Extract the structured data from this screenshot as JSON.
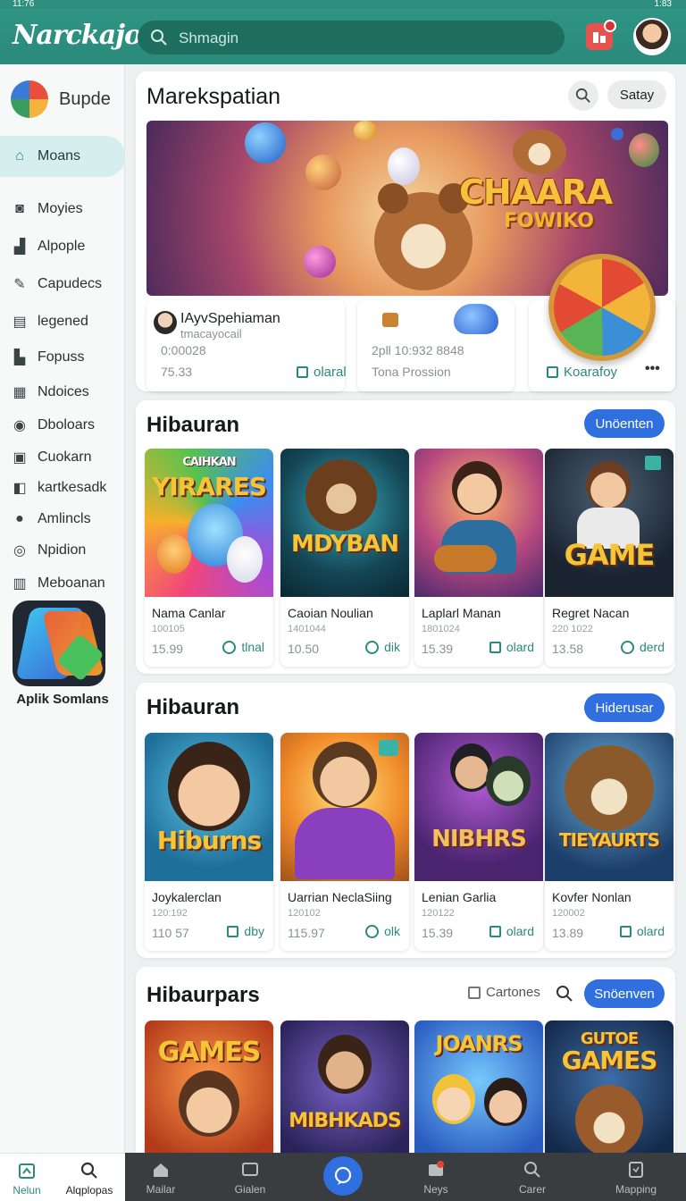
{
  "status": {
    "time": "11:76",
    "right": "1:83"
  },
  "app": {
    "logo": "Narckajoe"
  },
  "search": {
    "placeholder": "Shmagin"
  },
  "sidebar": {
    "brand": "Bupde",
    "items": [
      {
        "label": "Moans",
        "icon": "home-icon"
      },
      {
        "label": "Moyies",
        "icon": "camera-icon"
      },
      {
        "label": "Alpople",
        "icon": "thumb-icon"
      },
      {
        "label": "Capudecs",
        "icon": "pen-icon"
      },
      {
        "label": "legened",
        "icon": "list-icon"
      },
      {
        "label": "Fopuss",
        "icon": "chart-icon"
      },
      {
        "label": "Ndoices",
        "icon": "grid-icon"
      },
      {
        "label": "Dboloars",
        "icon": "eye-icon"
      },
      {
        "label": "Cuokarn",
        "icon": "board-icon"
      },
      {
        "label": "kartkesadk",
        "icon": "edit-icon"
      },
      {
        "label": "Amlincls",
        "icon": "pin-icon"
      },
      {
        "label": "Npidion",
        "icon": "location-icon"
      },
      {
        "label": "Meboanan",
        "icon": "calendar-icon"
      }
    ],
    "app_label": "Aplik Somlans"
  },
  "featured": {
    "title": "Marekspatian",
    "button": "Satay",
    "hero_title": "CHAARA",
    "hero_sub": "FOWIKO",
    "cards": [
      {
        "title": "IAyvSpehiaman",
        "subtitle": "tmacayocail",
        "id": "0:00028",
        "value": "75.33",
        "action": "olaral"
      },
      {
        "id": "2pll 10:932 8848",
        "value": "Tona Prossion"
      },
      {
        "action": "Koarafoy",
        "more": "•••"
      }
    ]
  },
  "section1": {
    "title": "Hibauran",
    "button": "Unöenten",
    "tiles": [
      {
        "art": "YIRARES",
        "art_top": "CAIHKAN",
        "name": "Nama Canlar",
        "id": "100105",
        "price": "15.99",
        "action": "tlnal"
      },
      {
        "art": "MDYBAN",
        "art_top": "",
        "name": "Caoian Noulian",
        "id": "1401044",
        "price": "10.50",
        "action": "dik"
      },
      {
        "art": "",
        "art_top": "",
        "name": "Laplarl Manan",
        "id": "1801024",
        "price": "15.39",
        "action": "olard"
      },
      {
        "art": "GAME",
        "art_top": "",
        "name": "Regret Nacan",
        "id": "220 1022",
        "price": "13.58",
        "action": "derd"
      }
    ]
  },
  "section2": {
    "title": "Hibauran",
    "button": "Hiderusar",
    "tiles": [
      {
        "art": "Hiburns",
        "name": "Joykalerclan",
        "id": "120:192",
        "price": "110 57",
        "action": "dby"
      },
      {
        "art": "",
        "name": "Uarrian NeclaSiing",
        "id": "120102",
        "price": "115.97",
        "action": "olk"
      },
      {
        "art": "NIBHRS",
        "name": "Lenian Garlia",
        "id": "120122",
        "price": "15.39",
        "action": "olard"
      },
      {
        "art": "TIEYAURTS",
        "name": "Kovfer Nonlan",
        "id": "120002",
        "price": "13.89",
        "action": "olard"
      }
    ]
  },
  "section3": {
    "title": "Hibaurpars",
    "filter": "Cartones",
    "button": "Snöenven",
    "tiles": [
      {
        "art": "GAMES"
      },
      {
        "art": "MIBHKADS"
      },
      {
        "art": "JOANRS"
      },
      {
        "art": "GAMES",
        "art_top": "GUTOE"
      }
    ]
  },
  "bottom_nav": {
    "left": [
      {
        "label": "Nelun",
        "icon": "home-icon"
      },
      {
        "label": "Alqplopas",
        "icon": "search-icon"
      }
    ],
    "right": [
      {
        "label": "Mailar",
        "icon": "house-icon"
      },
      {
        "label": "Gialen",
        "icon": "tv-icon"
      },
      {
        "label": "Neys",
        "icon": "inbox-icon"
      },
      {
        "label": "Carer",
        "icon": "search-icon"
      },
      {
        "label": "Mapping",
        "icon": "tag-icon"
      }
    ]
  },
  "colors": {
    "accent": "#2a8a7b",
    "primary_button": "#2f6fe0",
    "topbar": "#2e8f7e"
  }
}
